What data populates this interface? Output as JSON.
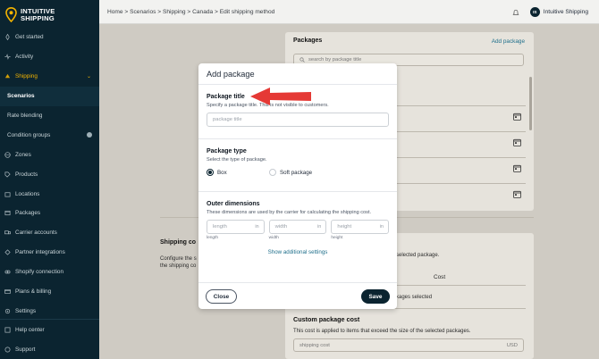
{
  "brand": {
    "line1": "INTUITIVE",
    "line2": "SHIPPING"
  },
  "sidebar": {
    "items": [
      {
        "label": "Get started",
        "icon": "rocket-icon"
      },
      {
        "label": "Activity",
        "icon": "activity-icon"
      },
      {
        "label": "Shipping",
        "icon": "shipping-icon"
      },
      {
        "label": "Scenarios",
        "icon": ""
      },
      {
        "label": "Rate blending",
        "icon": ""
      },
      {
        "label": "Condition groups",
        "icon": ""
      },
      {
        "label": "Zones",
        "icon": "globe-icon"
      },
      {
        "label": "Products",
        "icon": "tag-icon"
      },
      {
        "label": "Locations",
        "icon": "building-icon"
      },
      {
        "label": "Packages",
        "icon": "box-icon"
      },
      {
        "label": "Carrier accounts",
        "icon": "truck-icon"
      },
      {
        "label": "Partner integrations",
        "icon": "puzzle-icon"
      },
      {
        "label": "Shopify connection",
        "icon": "link-icon"
      },
      {
        "label": "Plans & billing",
        "icon": "card-icon"
      },
      {
        "label": "Settings",
        "icon": "gear-icon"
      }
    ],
    "bottom": [
      {
        "label": "Help center",
        "icon": "help-icon"
      },
      {
        "label": "Support",
        "icon": "support-icon"
      }
    ]
  },
  "breadcrumb": "Home > Scenarios > Shipping > Canada > Edit shipping method",
  "user": {
    "initials": "IS",
    "name": "Intuitive Shipping"
  },
  "background": {
    "packages_title": "Packages",
    "add_package_link": "Add package",
    "search_placeholder": "search by package title",
    "shipping_cost_title": "Shipping co",
    "shipping_cost_desc_1": "Configure the s",
    "shipping_cost_desc_2": "the shipping co",
    "selected_package_text": "selected package.",
    "cost_header": "Cost",
    "packages_selected_text": "kages selected",
    "custom_cost_title": "Custom package cost",
    "custom_cost_desc": "This cost is applied to items that exceed the size of the selected packages.",
    "shipping_cost_placeholder": "shipping cost",
    "currency": "USD"
  },
  "modal": {
    "title": "Add package",
    "package_title": {
      "heading": "Package title",
      "desc": "Specify a package title. This is not visible to customers.",
      "placeholder": "package title"
    },
    "package_type": {
      "heading": "Package type",
      "desc": "Select the type of package.",
      "options": [
        "Box",
        "Soft package"
      ],
      "selected": "Box"
    },
    "outer_dimensions": {
      "heading": "Outer dimensions",
      "desc": "These dimensions are used by the carrier for calculating the shipping cost.",
      "fields": [
        {
          "placeholder": "length",
          "unit": "in",
          "caption": "length"
        },
        {
          "placeholder": "width",
          "unit": "in",
          "caption": "width"
        },
        {
          "placeholder": "height",
          "unit": "in",
          "caption": "height"
        }
      ]
    },
    "show_more": "Show additional settings",
    "close_label": "Close",
    "save_label": "Save"
  },
  "colors": {
    "sidebar_bg": "#0b2430",
    "accent_arrow": "#e53935",
    "primary": "#0b2430",
    "logo": "#f4b400"
  }
}
